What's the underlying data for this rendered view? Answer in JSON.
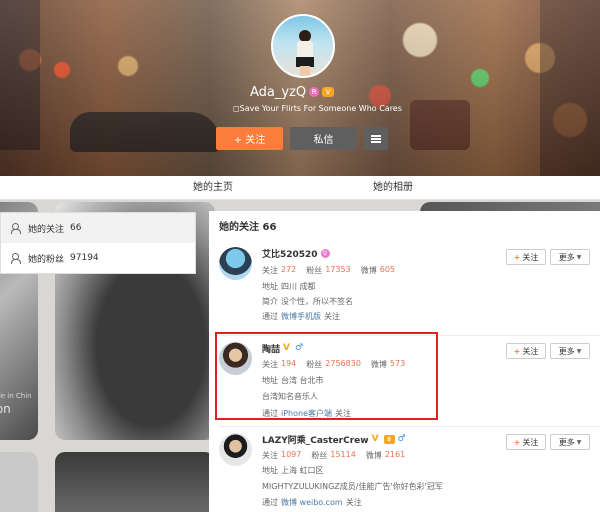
{
  "profile": {
    "username": "Ada_yzQ",
    "badge_r": "R",
    "badge_y": "V",
    "bio": "◻Save Your Flirts For Someone Who Cares",
    "follow_label": "+ 关注",
    "message_label": "私信"
  },
  "tabs": {
    "home": "她的主页",
    "album": "她的相册"
  },
  "left_menu": {
    "following_label": "她的关注",
    "following_count": "66",
    "fans_label": "她的粉丝",
    "fans_count": "97194"
  },
  "background": {
    "watermark": "oLon",
    "watermark_small": "Made in Chin"
  },
  "panel": {
    "title": "她的关注 66",
    "follow_btn": "关注",
    "more_btn": "更多",
    "users": [
      {
        "name": "艾比520520",
        "following_label": "关注",
        "following": "272",
        "fans_label": "粉丝",
        "fans": "17353",
        "weibo_label": "微博",
        "weibo": "605",
        "location_label": "地址",
        "location": "四川 成都",
        "intro_label": "简介",
        "intro": "没个性，所以不签名",
        "via_label": "通过",
        "via": "微博手机版",
        "via_suffix": "关注"
      },
      {
        "name": "陶喆",
        "following_label": "关注",
        "following": "194",
        "fans_label": "粉丝",
        "fans": "2756830",
        "weibo_label": "微博",
        "weibo": "573",
        "location_label": "地址",
        "location": "台湾 台北市",
        "intro": "台湾知名音乐人",
        "via_label": "通过",
        "via": "iPhone客户端",
        "via_suffix": "关注"
      },
      {
        "name": "LAZY阿乘_CasterCrew",
        "following_label": "关注",
        "following": "1097",
        "fans_label": "粉丝",
        "fans": "15114",
        "weibo_label": "微博",
        "weibo": "2161",
        "location_label": "地址",
        "location": "上海 虹口区",
        "intro": "MIGHTYZULUKINGZ成员/佳能广告'你好色彩'冠军",
        "via_label": "通过",
        "via": "微博 weibo.com",
        "via_suffix": "关注"
      }
    ]
  },
  "colors": {
    "orange": "#fa7d3c",
    "link": "#4a7aa8",
    "number": "#eb7350",
    "highlight": "#e02020"
  }
}
